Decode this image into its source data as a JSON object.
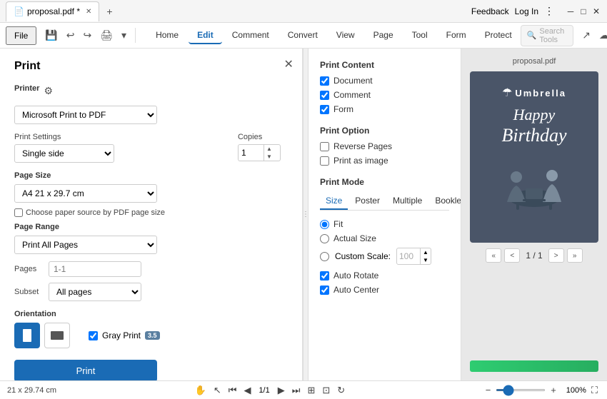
{
  "window": {
    "title": "proposal.pdf *",
    "feedback_label": "Feedback",
    "login_label": "Log In"
  },
  "menubar": {
    "file_label": "File",
    "nav_items": [
      {
        "id": "home",
        "label": "Home"
      },
      {
        "id": "edit",
        "label": "Edit",
        "active": true
      },
      {
        "id": "comment",
        "label": "Comment"
      },
      {
        "id": "convert",
        "label": "Convert"
      },
      {
        "id": "view",
        "label": "View"
      },
      {
        "id": "page",
        "label": "Page"
      },
      {
        "id": "tool",
        "label": "Tool"
      },
      {
        "id": "form",
        "label": "Form"
      },
      {
        "id": "protect",
        "label": "Protect"
      }
    ],
    "search_placeholder": "Search Tools"
  },
  "print_panel": {
    "title": "Print",
    "printer_label": "Printer",
    "printer_value": "Microsoft Print to PDF",
    "print_settings_label": "Print Settings",
    "single_side_label": "Single side",
    "copies_label": "Copies",
    "copies_value": "1",
    "page_size_label": "Page Size",
    "page_size_value": "A4 21 x 29.7 cm",
    "choose_paper_label": "Choose paper source by PDF page size",
    "page_range_label": "Page Range",
    "page_range_value": "Print All Pages",
    "pages_label": "Pages",
    "pages_placeholder": "1-1",
    "subset_label": "Subset",
    "subset_value": "All pages",
    "orientation_label": "Orientation",
    "orient_portrait": "portrait",
    "orient_landscape": "landscape",
    "gray_print_label": "Gray Print",
    "gray_badge": "3.5",
    "print_button_label": "Print"
  },
  "print_options": {
    "print_content_title": "Print Content",
    "document_label": "Document",
    "comment_label": "Comment",
    "form_label": "Form",
    "document_checked": true,
    "comment_checked": true,
    "form_checked": true,
    "print_option_title": "Print Option",
    "reverse_pages_label": "Reverse Pages",
    "print_as_image_label": "Print as image",
    "reverse_checked": false,
    "print_image_checked": false,
    "print_mode_title": "Print Mode",
    "mode_tabs": [
      {
        "id": "size",
        "label": "Size",
        "active": true
      },
      {
        "id": "poster",
        "label": "Poster"
      },
      {
        "id": "multiple",
        "label": "Multiple"
      },
      {
        "id": "booklet",
        "label": "Booklet"
      }
    ],
    "fit_label": "Fit",
    "actual_size_label": "Actual Size",
    "custom_scale_label": "Custom Scale:",
    "scale_value": "100",
    "auto_rotate_label": "Auto Rotate",
    "auto_center_label": "Auto Center",
    "auto_rotate_checked": true,
    "auto_center_checked": true
  },
  "preview": {
    "filename": "proposal.pdf",
    "page_count": "1 / 1",
    "umbrella_name": "Umbrella",
    "happy_text": "Happy",
    "birthday_text": "Birthday",
    "nav_first": "«",
    "nav_prev": "<",
    "nav_next": ">",
    "nav_last": "»"
  },
  "statusbar": {
    "doc_size": "21 x 29.74 cm",
    "page_display": "1/1",
    "zoom_percent": "100%"
  }
}
